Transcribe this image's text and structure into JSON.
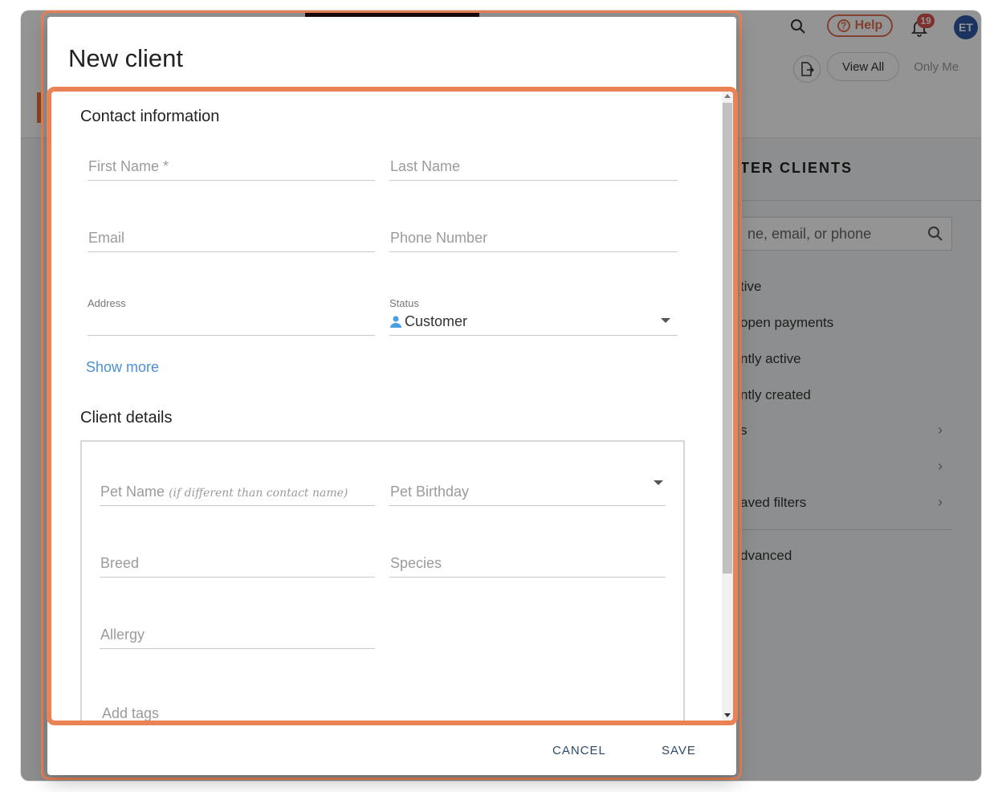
{
  "background": {
    "topbar": {
      "help_label": "Help",
      "notifications_count": "19",
      "avatar_initials": "ET"
    },
    "view_toggle": {
      "view_all": "View All",
      "only_me": "Only Me"
    },
    "filter_panel": {
      "title": "TER CLIENTS",
      "search_placeholder": "ne, email, or phone",
      "items": [
        {
          "label": "tive"
        },
        {
          "label": "open payments"
        },
        {
          "label": "ntly active"
        },
        {
          "label": "ntly created"
        },
        {
          "label": "s"
        },
        {
          "label": ""
        },
        {
          "label": "aved filters"
        },
        {
          "label": "dvanced"
        }
      ]
    }
  },
  "dialog": {
    "title": "New client",
    "contact": {
      "heading": "Contact information",
      "first_name_ph": "First Name *",
      "last_name_ph": "Last Name",
      "email_ph": "Email",
      "phone_ph": "Phone Number",
      "address_label": "Address",
      "status_label": "Status",
      "status_value": "Customer",
      "show_more": "Show more"
    },
    "details": {
      "heading": "Client details",
      "pet_name_ph": "Pet Name",
      "pet_name_hint": "(if different than contact name)",
      "pet_birthday_ph": "Pet Birthday",
      "breed_ph": "Breed",
      "species_ph": "Species",
      "allergy_ph": "Allergy",
      "tags_ph": "Add tags"
    },
    "buttons": {
      "cancel": "CANCEL",
      "save": "SAVE"
    }
  },
  "colors": {
    "accent": "#e98356",
    "link": "#4a90d9",
    "avatar": "#3059a8",
    "badge": "#d9534f"
  }
}
